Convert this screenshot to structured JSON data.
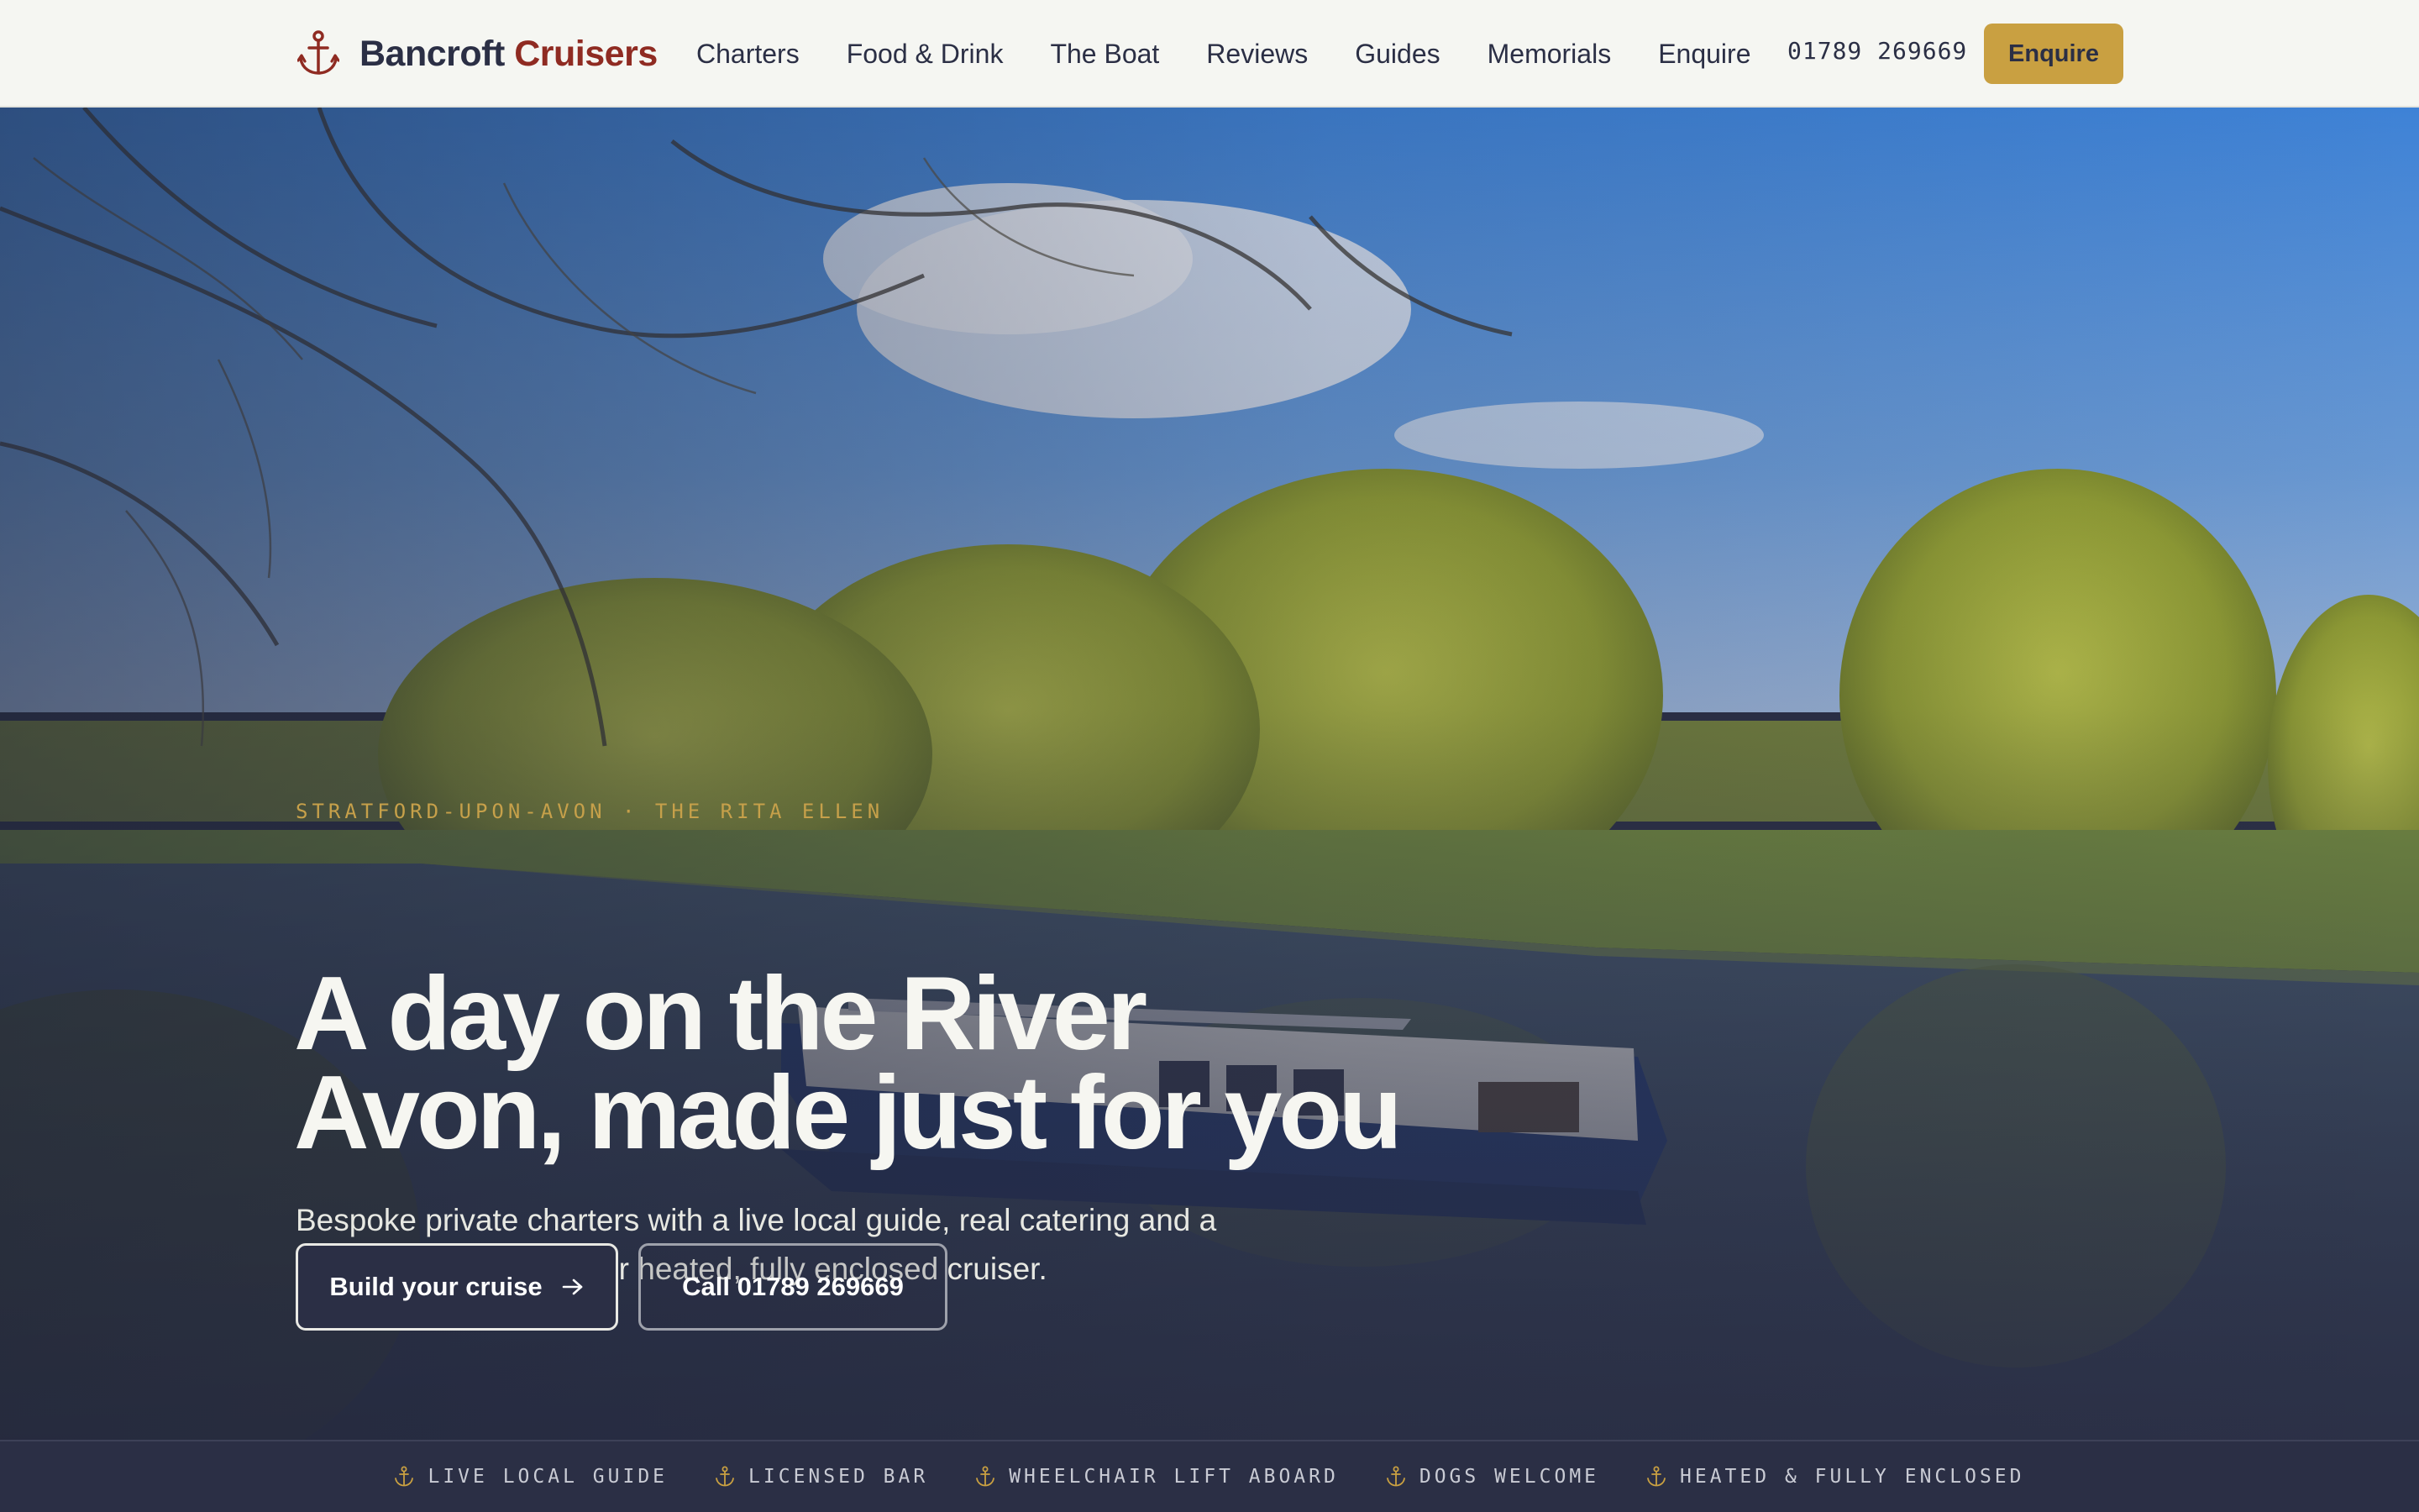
{
  "brand": {
    "name": "Bancroft",
    "accent": "Cruisers",
    "icon": "anchor-icon",
    "name_color": "#2b2f45",
    "accent_color": "#8f2b22"
  },
  "nav": {
    "items": [
      {
        "label": "Charters"
      },
      {
        "label": "Food & Drink"
      },
      {
        "label": "The Boat"
      },
      {
        "label": "Reviews"
      },
      {
        "label": "Guides"
      },
      {
        "label": "Memorials"
      },
      {
        "label": "Enquire"
      }
    ],
    "phone": "01789 269669",
    "cta_label": "Enquire",
    "cta_color": "#c9a041"
  },
  "hero": {
    "eyebrow": "STRATFORD-UPON-AVON · THE RITA ELLEN",
    "title_line1": "A day on the River",
    "title_line2": "Avon, made just for you",
    "subtitle": "Bespoke private charters with a live local guide, real catering and a licensed bar, aboard our heated, fully enclosed cruiser.",
    "primary_button": "Build your cruise",
    "primary_icon": "arrow-right-icon",
    "secondary_button": "Call 01789 269669",
    "image": "river-avon-cruiser-photo"
  },
  "features": {
    "icon": "anchor-icon",
    "items": [
      {
        "label": "LIVE LOCAL GUIDE"
      },
      {
        "label": "LICENSED BAR"
      },
      {
        "label": "WHEELCHAIR LIFT ABOARD"
      },
      {
        "label": "DOGS WELCOME"
      },
      {
        "label": "HEATED & FULLY ENCLOSED"
      }
    ]
  },
  "colors": {
    "navy": "#2b2f45",
    "gold": "#c9a041",
    "header_bg": "#f5f6f2"
  }
}
